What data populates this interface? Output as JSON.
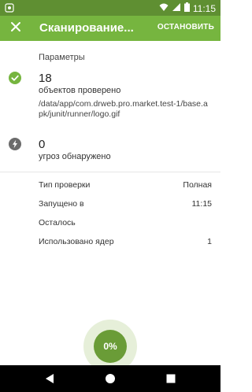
{
  "status_bar": {
    "time": "11:15"
  },
  "app_bar": {
    "title": "Сканирование...",
    "stop_label": "ОСТАНОВИТЬ"
  },
  "params": {
    "section_label": "Параметры"
  },
  "checked": {
    "count": "18",
    "label": "объектов проверено",
    "path": "/data/app/com.drweb.pro.market.test-1/base.apk/junit/runner/logo.gif"
  },
  "threats": {
    "count": "0",
    "label": "угроз обнаружено"
  },
  "info": [
    {
      "key": "Тип проверки",
      "value": "Полная"
    },
    {
      "key": "Запущено в",
      "value": "11:15"
    },
    {
      "key": "Осталось",
      "value": ""
    },
    {
      "key": "Использовано ядер",
      "value": "1"
    }
  ],
  "progress": {
    "label": "0%"
  },
  "colors": {
    "accent": "#76b53f",
    "status_bar": "#5f8f32",
    "progress": "#6a9c37"
  }
}
